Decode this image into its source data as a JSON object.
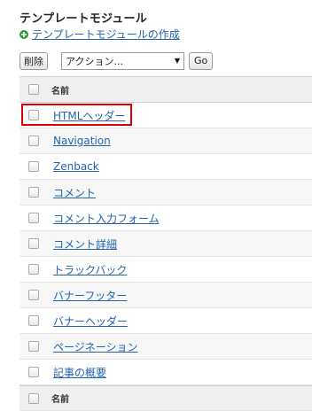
{
  "page": {
    "title": "テンプレートモジュール",
    "create_link": "テンプレートモジュールの作成"
  },
  "toolbar": {
    "delete_label": "削除",
    "action_select_value": "アクション...",
    "go_label": "Go"
  },
  "table": {
    "header_label": "名前",
    "footer_label": "名前",
    "rows": [
      {
        "name": "HTMLヘッダー"
      },
      {
        "name": "Navigation"
      },
      {
        "name": "Zenback"
      },
      {
        "name": "コメント"
      },
      {
        "name": "コメント入力フォーム"
      },
      {
        "name": "コメント詳細"
      },
      {
        "name": "トラックバック"
      },
      {
        "name": "バナーフッター"
      },
      {
        "name": "バナーヘッダー"
      },
      {
        "name": "ページネーション"
      },
      {
        "name": "記事の概要"
      }
    ]
  },
  "colors": {
    "link": "#2264b0",
    "highlight": "#e10000",
    "plus_icon": "#2e9a3e"
  }
}
